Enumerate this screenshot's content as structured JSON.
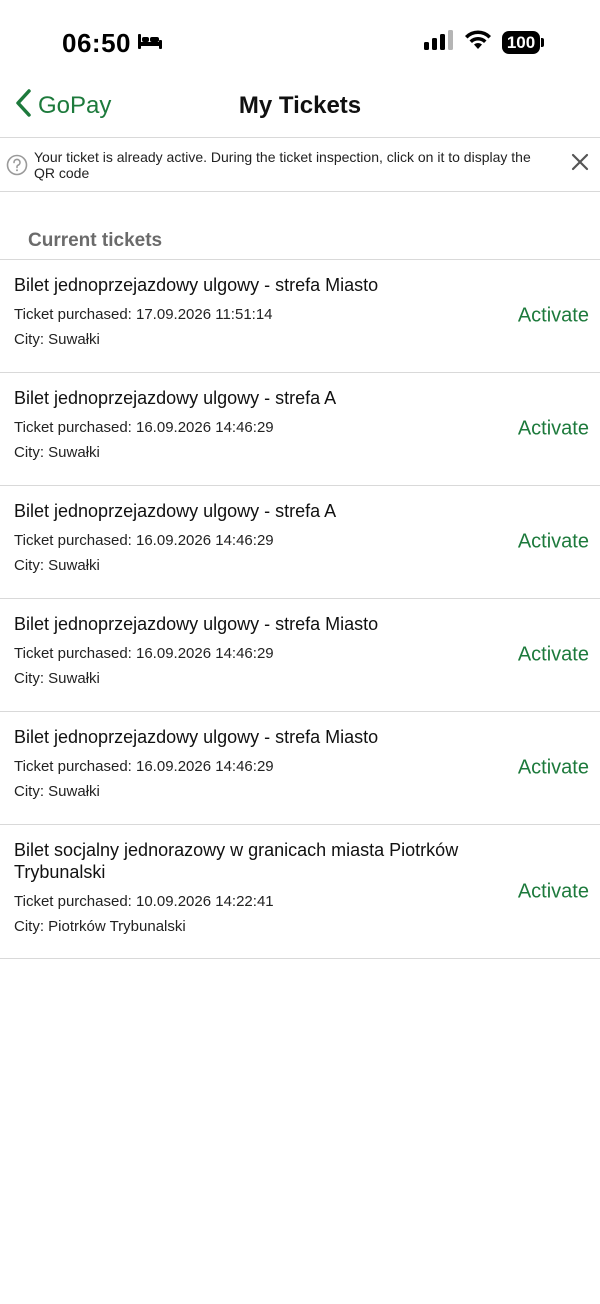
{
  "status_bar": {
    "time": "06:50",
    "battery": "100"
  },
  "nav": {
    "back_label": "GoPay",
    "title": "My Tickets"
  },
  "banner": {
    "text": "Your ticket is already active. During the ticket inspection, click on it to display the QR code"
  },
  "section": {
    "title": "Current tickets"
  },
  "tickets": [
    {
      "name": "Bilet jednoprzejazdowy ulgowy - strefa Miasto",
      "purchased": "Ticket purchased: 17.09.2026 11:51:14",
      "city": "City: Suwałki",
      "action": "Activate"
    },
    {
      "name": "Bilet jednoprzejazdowy ulgowy - strefa A",
      "purchased": "Ticket purchased: 16.09.2026 14:46:29",
      "city": "City: Suwałki",
      "action": "Activate"
    },
    {
      "name": "Bilet jednoprzejazdowy ulgowy - strefa A",
      "purchased": "Ticket purchased: 16.09.2026 14:46:29",
      "city": "City: Suwałki",
      "action": "Activate"
    },
    {
      "name": "Bilet jednoprzejazdowy ulgowy - strefa Miasto",
      "purchased": "Ticket purchased: 16.09.2026 14:46:29",
      "city": "City: Suwałki",
      "action": "Activate"
    },
    {
      "name": "Bilet jednoprzejazdowy ulgowy - strefa Miasto",
      "purchased": "Ticket purchased: 16.09.2026 14:46:29",
      "city": "City: Suwałki",
      "action": "Activate"
    },
    {
      "name": "Bilet socjalny jednorazowy w granicach miasta Piotrków Trybunalski",
      "purchased": "Ticket purchased: 10.09.2026 14:22:41",
      "city": "City: Piotrków Trybunalski",
      "action": "Activate"
    }
  ],
  "colors": {
    "accent": "#1d7a3c",
    "divider": "#d9d9d9",
    "section_header": "#6b6b6b"
  },
  "icons": {
    "status": [
      "bed-icon",
      "cellular-signal-icon",
      "wifi-icon",
      "battery-icon"
    ],
    "nav": "chevron-left-icon",
    "banner": [
      "question-circle-icon",
      "close-icon"
    ]
  }
}
